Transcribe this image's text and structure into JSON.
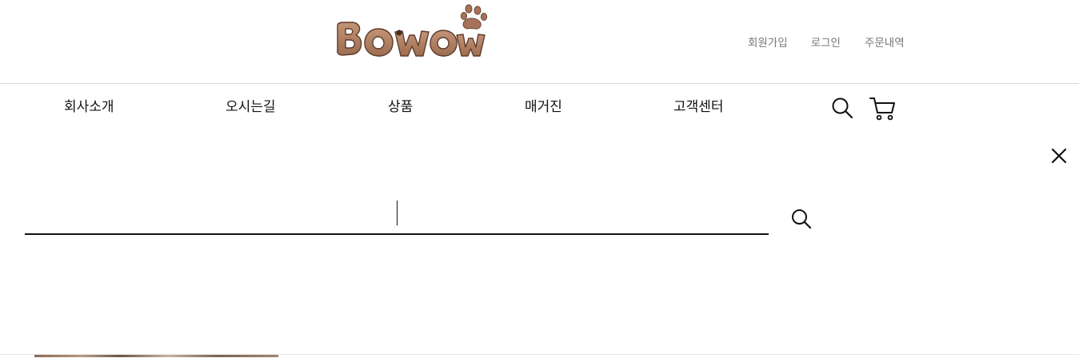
{
  "header": {
    "logo_text": "BOWOW",
    "util_links": {
      "join": "회원가입",
      "login": "로그인",
      "orders": "주문내역"
    }
  },
  "nav": {
    "company": "회사소개",
    "location": "오시는길",
    "product": "상품",
    "magazine": "매거진",
    "support": "고객센터"
  },
  "icons": {
    "nav_search": "search-icon",
    "nav_cart": "cart-icon",
    "close": "close-icon",
    "search_submit": "search-icon"
  },
  "search": {
    "value": "",
    "placeholder": ""
  },
  "colors": {
    "brand_brown": "#b07d5f",
    "brand_dark": "#6a4634",
    "underline": "#111111"
  }
}
